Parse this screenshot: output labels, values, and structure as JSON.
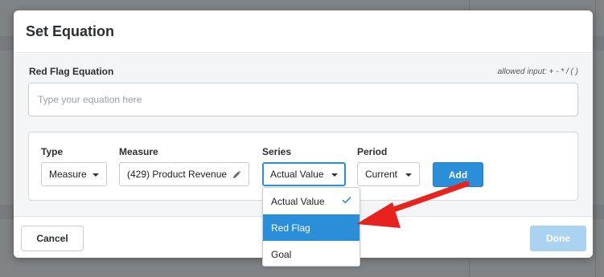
{
  "modal": {
    "title": "Set Equation"
  },
  "equation": {
    "label": "Red Flag Equation",
    "hint": "allowed input: + - * / ( )",
    "value": "",
    "placeholder": "Type your equation here"
  },
  "builder": {
    "type": {
      "label": "Type",
      "value": "Measure"
    },
    "measure": {
      "label": "Measure",
      "value": "(429) Product Revenue"
    },
    "series": {
      "label": "Series",
      "value": "Actual Value"
    },
    "period": {
      "label": "Period",
      "value": "Current"
    },
    "add_label": "Add"
  },
  "series_dropdown": {
    "items": [
      {
        "label": "Actual Value",
        "selected": true
      },
      {
        "label": "Red Flag",
        "highlighted": true
      },
      {
        "label": "Goal"
      }
    ]
  },
  "footer": {
    "cancel_label": "Cancel",
    "done_label": "Done"
  },
  "colors": {
    "accent": "#2a8fd8",
    "disabled_button": "#a9d3f1",
    "annotation_arrow": "#e8221c"
  },
  "icons": {
    "measure_edit": "pencil-icon",
    "selected_option": "checkmark-icon",
    "dropdown_caret": "caret-down-icon"
  }
}
